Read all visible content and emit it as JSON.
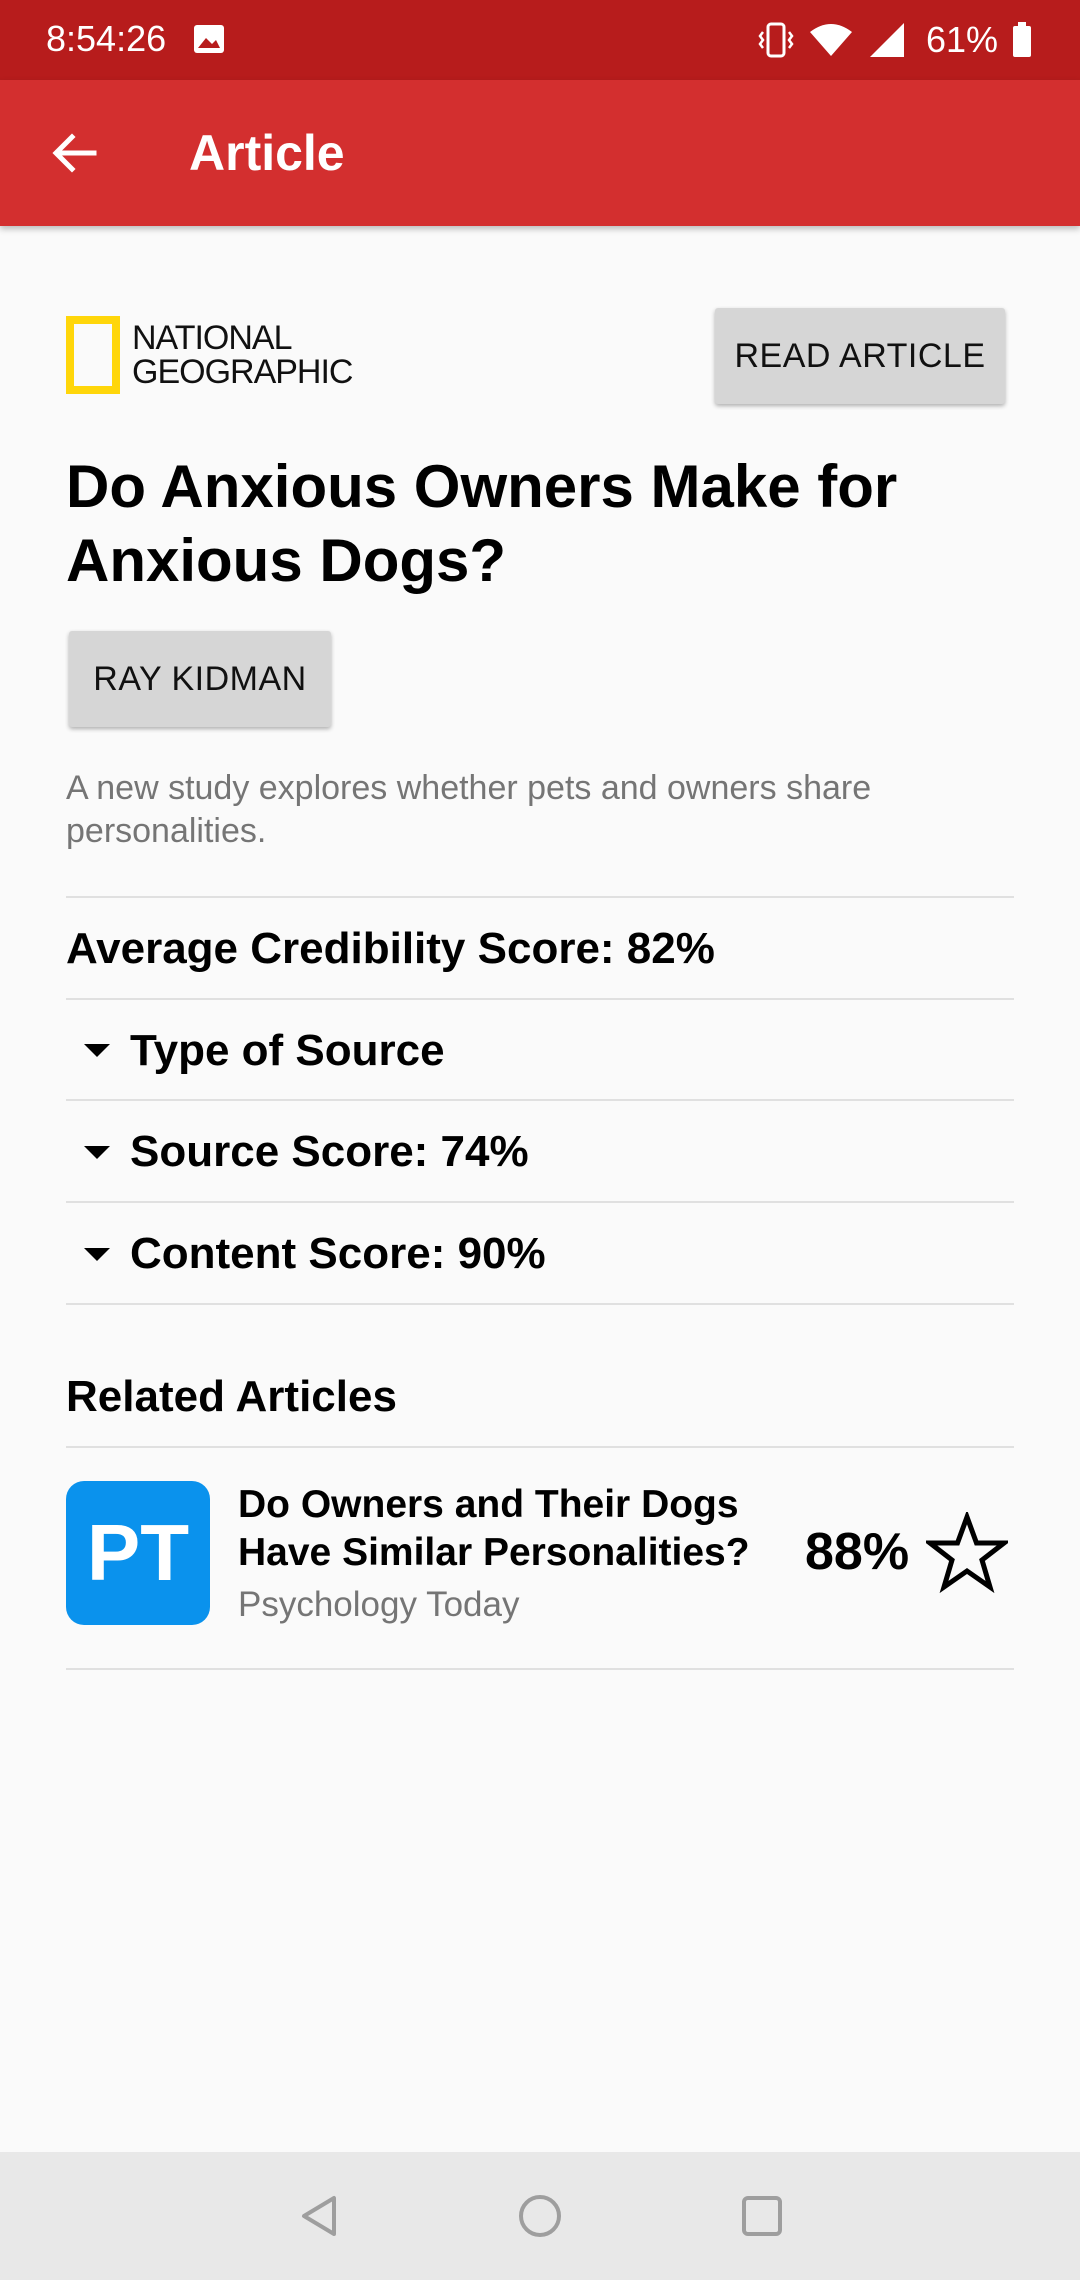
{
  "status_bar": {
    "time": "8:54:26",
    "battery": "61%"
  },
  "app_bar": {
    "title": "Article"
  },
  "article": {
    "publisher_logo_line1": "NATIONAL",
    "publisher_logo_line2": "GEOGRAPHIC",
    "read_button": "READ ARTICLE",
    "headline": "Do Anxious Owners Make for Anxious Dogs?",
    "author": "RAY KIDMAN",
    "description": "A new study explores whether pets and owners share personalities."
  },
  "scores": {
    "average": "Average Credibility Score: 82%",
    "type_of_source": "Type of Source",
    "source_score": "Source Score: 74%",
    "content_score": "Content Score: 90%"
  },
  "related": {
    "title": "Related Articles",
    "items": [
      {
        "icon_text": "PT",
        "headline": "Do Owners and Their Dogs Have Similar Personalities?",
        "source": "Psychology Today",
        "score": "88%"
      }
    ]
  },
  "colors": {
    "status_bar": "#b71c1c",
    "app_bar": "#d32f2f",
    "logo_yellow": "#ffd60a",
    "pt_blue": "#0a92ed"
  }
}
